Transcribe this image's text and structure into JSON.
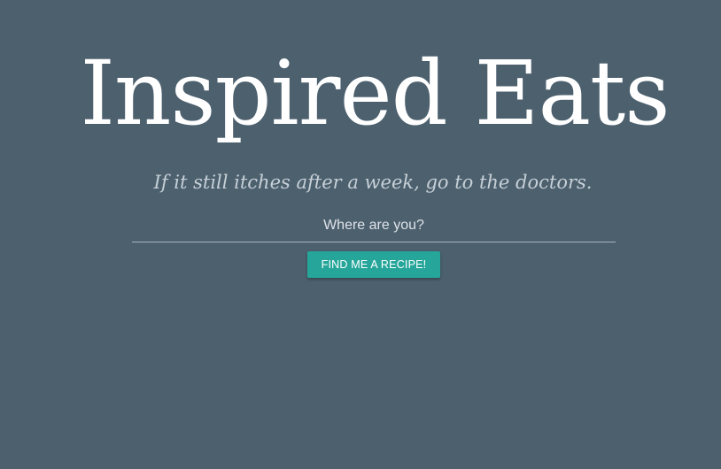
{
  "hero": {
    "title": "Inspired Eats",
    "tagline": "If it still itches after a week, go to the doctors."
  },
  "search": {
    "placeholder": "Where are you?",
    "value": ""
  },
  "actions": {
    "find_label": "FIND ME A RECIPE!"
  },
  "colors": {
    "background": "#4d606e",
    "accent": "#26a69a",
    "title_text": "#ffffff",
    "tagline_text": "#c6d0d7"
  }
}
